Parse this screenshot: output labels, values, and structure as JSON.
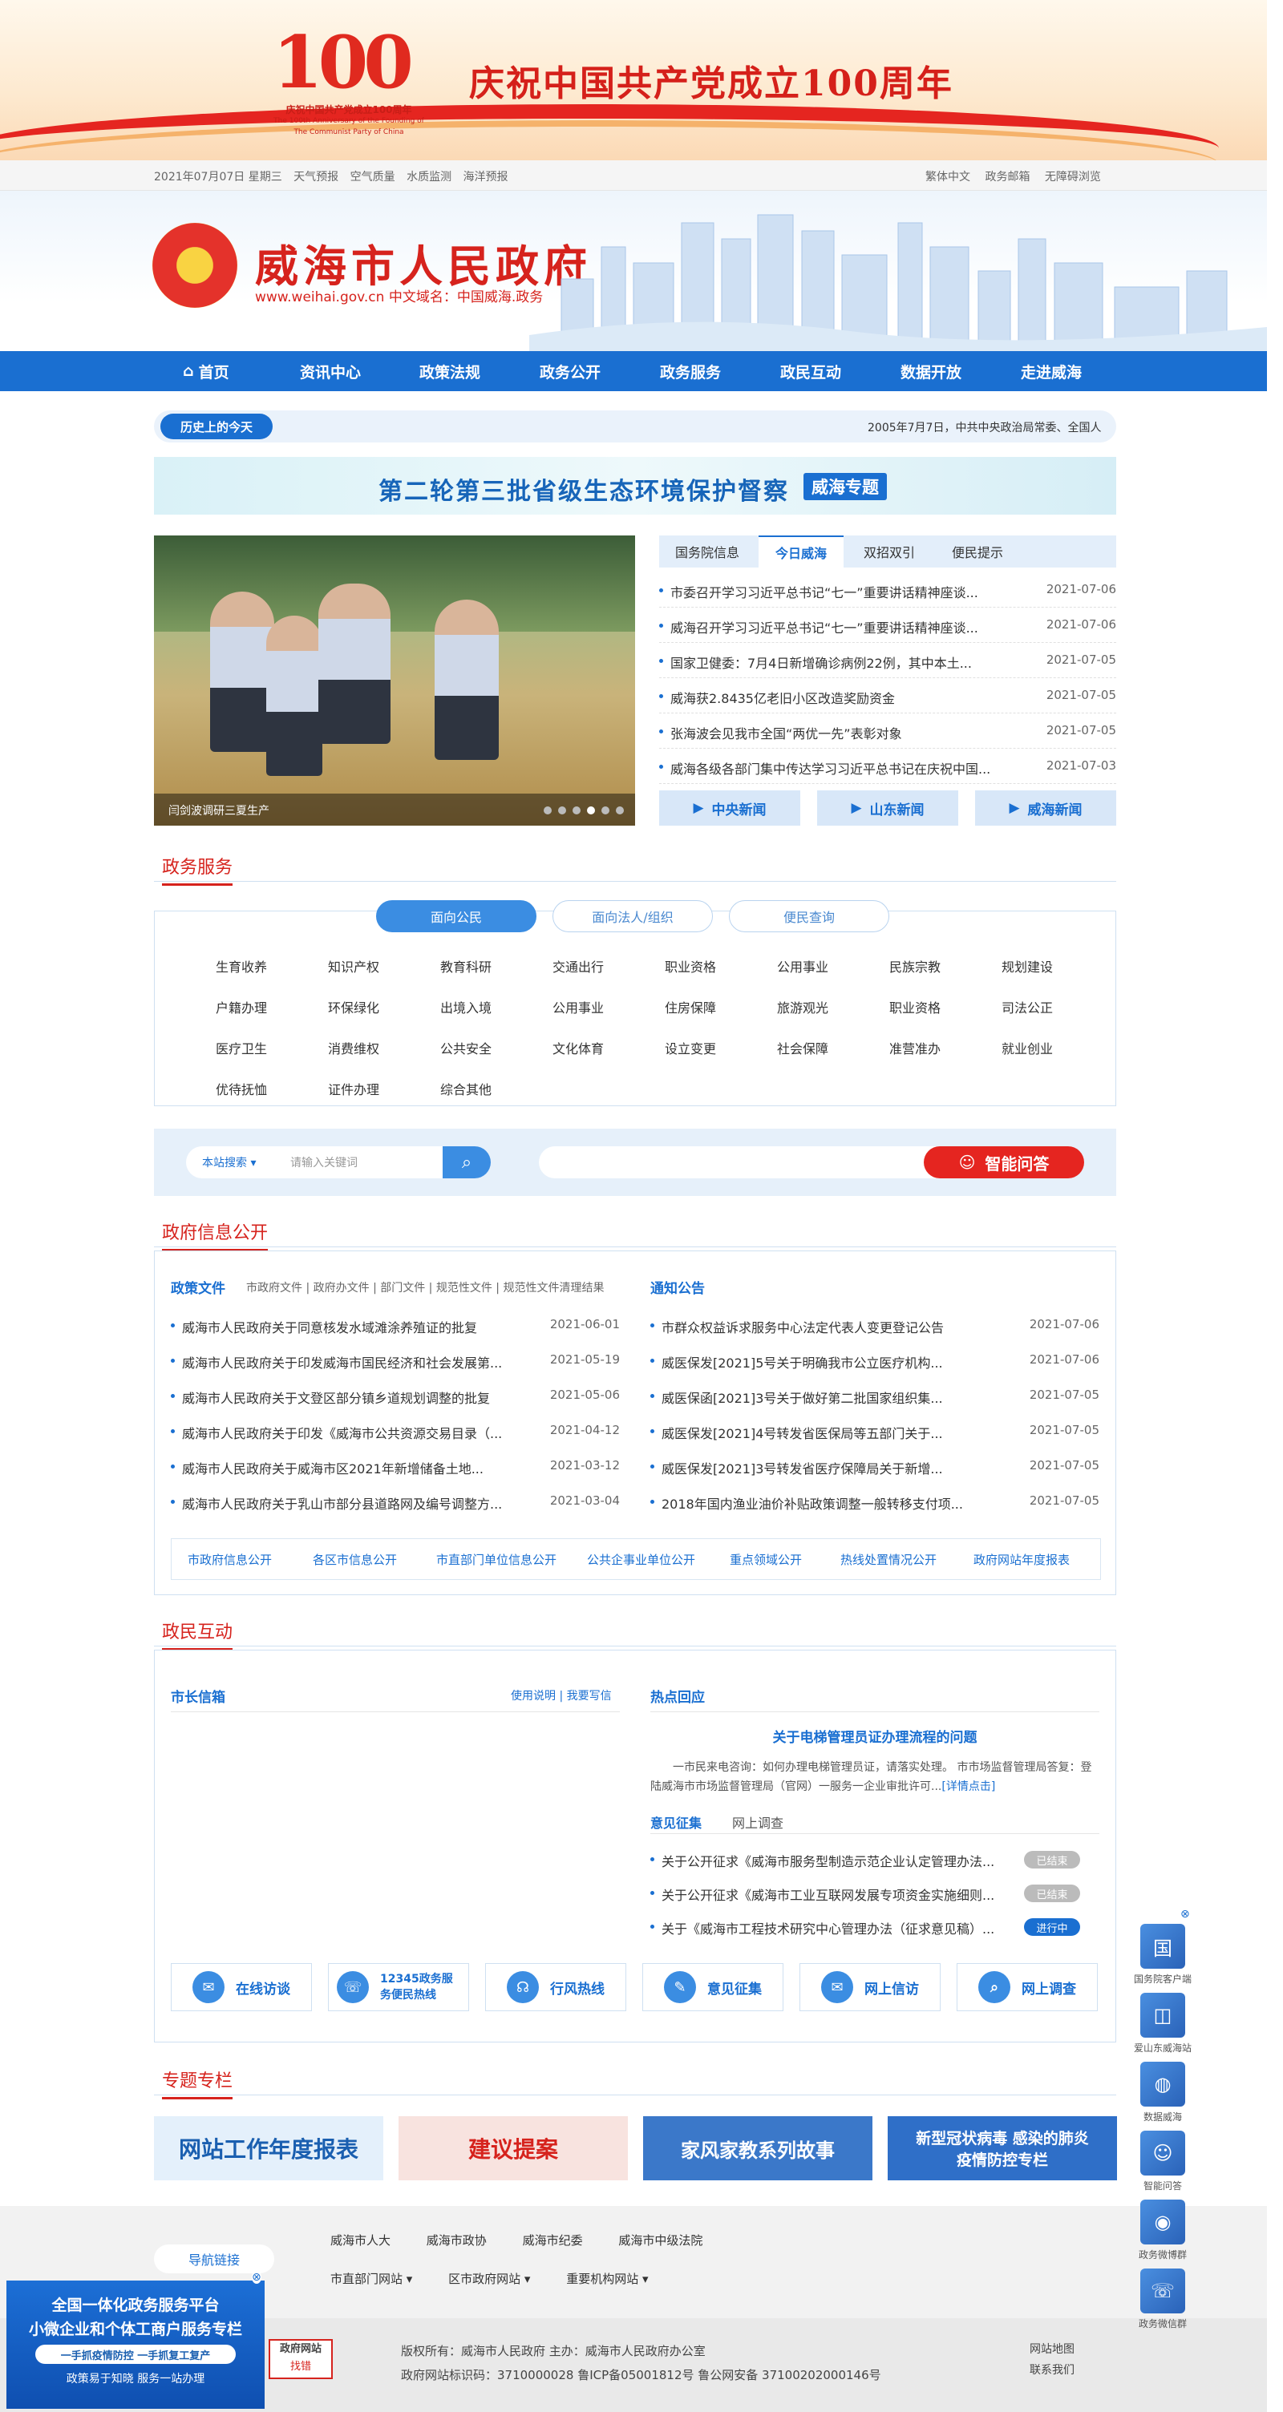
{
  "banner": {
    "logo_number": "100",
    "logo_sub1": "庆祝中国共产党成立100周年",
    "logo_sub2": "The 100th Anniversary of the Founding of",
    "logo_sub3": "The Communist Party of China",
    "title": "庆祝中国共产党成立100周年"
  },
  "topbar": {
    "left": [
      "2021年07月07日 星期三",
      "天气预报",
      "空气质量",
      "水质监测",
      "海洋预报"
    ],
    "right": [
      "繁体中文",
      "政务邮箱",
      "无障碍浏览"
    ]
  },
  "header": {
    "site_name": "威海市人民政府",
    "url": "www.weihai.gov.cn  中文域名：中国威海.政务"
  },
  "nav": [
    "首页",
    "资讯中心",
    "政策法规",
    "政务公开",
    "政务服务",
    "政民互动",
    "数据开放",
    "走进威海"
  ],
  "today": {
    "tag": "历史上的今天",
    "text": "2005年7月7日，中共中央政治局常委、全国人"
  },
  "eco": {
    "title": "第二轮第三批省级生态环境保护督察",
    "tag": "威海专题"
  },
  "slide": {
    "caption": "闫剑波调研三夏生产",
    "dots": 6,
    "active_dot": 4
  },
  "news": {
    "tabs": [
      "国务院信息",
      "今日威海",
      "双招双引",
      "便民提示"
    ],
    "active_tab": 1,
    "items": [
      {
        "t": "市委召开学习习近平总书记“七一”重要讲话精神座谈...",
        "d": "2021-07-06"
      },
      {
        "t": "威海召开学习习近平总书记“七一”重要讲话精神座谈...",
        "d": "2021-07-06"
      },
      {
        "t": "国家卫健委：7月4日新增确诊病例22例，其中本土...",
        "d": "2021-07-05"
      },
      {
        "t": "威海获2.8435亿老旧小区改造奖励资金",
        "d": "2021-07-05"
      },
      {
        "t": "张海波会见我市全国“两优一先”表彰对象",
        "d": "2021-07-05"
      },
      {
        "t": "威海各级各部门集中传达学习习近平总书记在庆祝中国...",
        "d": "2021-07-03"
      }
    ],
    "buttons": [
      "中央新闻",
      "山东新闻",
      "威海新闻"
    ]
  },
  "sections": {
    "service": "政务服务",
    "info": "政府信息公开",
    "interact": "政民互动",
    "topics": "专题专栏"
  },
  "service": {
    "pills": [
      "面向公民",
      "面向法人/组织",
      "便民查询"
    ],
    "items": [
      "生育收养",
      "知识产权",
      "教育科研",
      "交通出行",
      "职业资格",
      "公用事业",
      "民族宗教",
      "规划建设",
      "户籍办理",
      "环保绿化",
      "出境入境",
      "公用事业",
      "住房保障",
      "旅游观光",
      "职业资格",
      "司法公正",
      "医疗卫生",
      "消费维权",
      "公共安全",
      "文化体育",
      "设立变更",
      "社会保障",
      "准营准办",
      "就业创业",
      "优待抚恤",
      "证件办理",
      "综合其他"
    ]
  },
  "search": {
    "scope": "本站搜索",
    "placeholder": "请输入关键词",
    "ask": "智能问答"
  },
  "info": {
    "policy_title": "政策文件",
    "policy_tabs": "市政府文件 | 政府办文件 | 部门文件 | 规范性文件 | 规范性文件清理结果",
    "policy": [
      {
        "t": "威海市人民政府关于同意核发水域滩涂养殖证的批复",
        "d": "2021-06-01"
      },
      {
        "t": "威海市人民政府关于印发威海市国民经济和社会发展第...",
        "d": "2021-05-19"
      },
      {
        "t": "威海市人民政府关于文登区部分镇乡道规划调整的批复",
        "d": "2021-05-06"
      },
      {
        "t": "威海市人民政府关于印发《威海市公共资源交易目录（...",
        "d": "2021-04-12"
      },
      {
        "t": "威海市人民政府关于威海市区2021年新增储备土地...",
        "d": "2021-03-12"
      },
      {
        "t": "威海市人民政府关于乳山市部分县道路网及编号调整方...",
        "d": "2021-03-04"
      }
    ],
    "notice_title": "通知公告",
    "notice": [
      {
        "t": "市群众权益诉求服务中心法定代表人变更登记公告",
        "d": "2021-07-06"
      },
      {
        "t": "威医保发[2021]5号关于明确我市公立医疗机构...",
        "d": "2021-07-06"
      },
      {
        "t": "威医保函[2021]3号关于做好第二批国家组织集...",
        "d": "2021-07-05"
      },
      {
        "t": "威医保发[2021]4号转发省医保局等五部门关于...",
        "d": "2021-07-05"
      },
      {
        "t": "威医保发[2021]3号转发省医疗保障局关于新增...",
        "d": "2021-07-05"
      },
      {
        "t": "2018年国内渔业油价补贴政策调整一般转移支付项...",
        "d": "2021-07-05"
      }
    ],
    "links": [
      "市政府信息公开",
      "各区市信息公开",
      "市直部门单位信息公开",
      "公共企事业单位公开",
      "重点领域公开",
      "热线处置情况公开",
      "政府网站年度报表"
    ]
  },
  "interact": {
    "mayor_title": "市长信箱",
    "mayor_links": "使用说明 | 我要写信",
    "hot_title": "热点回应",
    "hot_headline": "关于电梯管理员证办理流程的问题",
    "hot_body": "一市民来电咨询：如何办理电梯管理员证，请落实处理。 市市场监督管理局答复：登陆威海市市场监督管理局（官网）一服务一企业审批许可...",
    "hot_more": "[详情点击]",
    "opinion_tabs": [
      "意见征集",
      "网上调查"
    ],
    "opinions": [
      {
        "t": "关于公开征求《威海市服务型制造示范企业认定管理办法...",
        "s": "已结束",
        "c": "#bbbbbb"
      },
      {
        "t": "关于公开征求《威海市工业互联网发展专项资金实施细则...",
        "s": "已结束",
        "c": "#bbbbbb"
      },
      {
        "t": "关于《威海市工程技术研究中心管理办法（征求意见稿）...",
        "s": "进行中",
        "c": "#1a6fd1"
      }
    ],
    "buttons": [
      "在线访谈",
      "12345政务服务便民热线",
      "行风热线",
      "意见征集",
      "网上信访",
      "网上调查"
    ]
  },
  "topics": [
    {
      "t": "网站工作年度报表",
      "bg": "#e4f0fb",
      "fg": "#1a5fb0"
    },
    {
      "t": "建议提案",
      "bg": "#f8e3df",
      "fg": "#d6231d"
    },
    {
      "t": "家风家教系列故事",
      "bg": "#3b78c9",
      "fg": "#ffffff"
    },
    {
      "t": "新型冠状病毒 感染的肺炎疫情防控专栏",
      "bg": "#2f6fc8",
      "fg": "#ffffff"
    }
  ],
  "footer_links": {
    "label": "导航链接",
    "row1": [
      "威海市人大",
      "威海市政协",
      "威海市纪委",
      "威海市中级法院"
    ],
    "row2": [
      "市直部门网站",
      "区市政府网站",
      "重要机构网站"
    ]
  },
  "footer": {
    "badge_top": "政府网站",
    "badge_bottom": "找错",
    "line1": "版权所有：威海市人民政府    主办：威海市人民政府办公室",
    "line2": "政府网站标识码：3710000028      鲁ICP备05001812号      鲁公网安备 37100202000146号",
    "right1": "网站地图",
    "right2": "联系我们"
  },
  "float_right": [
    "国务院客户端",
    "爱山东威海站",
    "数据威海",
    "智能问答",
    "政务微博群",
    "政务微信群"
  ],
  "float_left": {
    "l1": "全国一体化政务服务平台",
    "l2": "小微企业和个体工商户服务专栏",
    "l3": "一手抓疫情防控 一手抓复工复产",
    "l4": "政策易于知晓 服务一站办理"
  }
}
